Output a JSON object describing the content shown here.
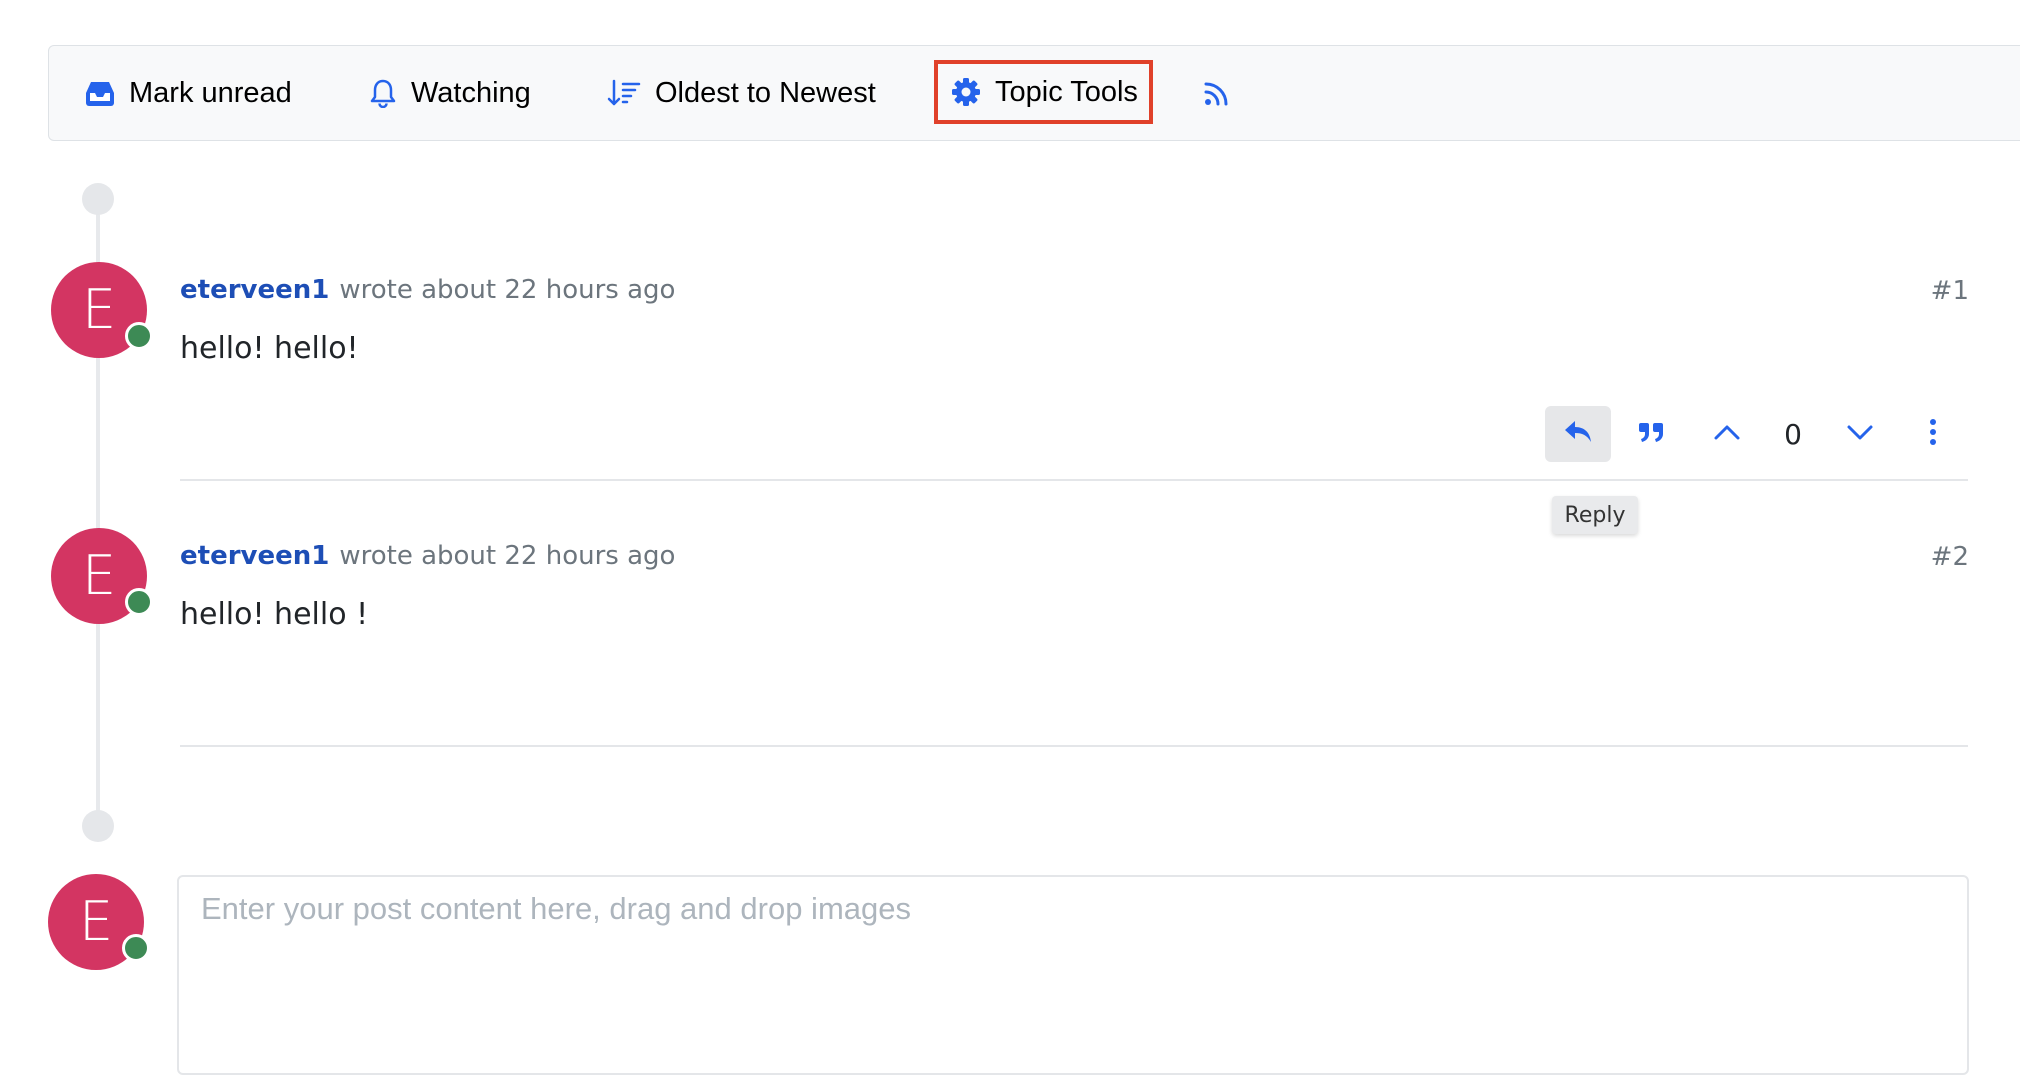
{
  "toolbar": {
    "mark_unread": "Mark unread",
    "watching": "Watching",
    "sort": "Oldest to Newest",
    "topic_tools": "Topic Tools"
  },
  "colors": {
    "accent": "#2563eb",
    "avatar": "#d33562",
    "online": "#3d8a55",
    "highlight_border": "#e0412a",
    "username": "#1d4eb6"
  },
  "posts": [
    {
      "avatar_letter": "E",
      "username": "eterveen1",
      "meta": "wrote about 22 hours ago",
      "index": "#1",
      "content": "hello! hello!",
      "votes": "0"
    },
    {
      "avatar_letter": "E",
      "username": "eterveen1",
      "meta": "wrote about 22 hours ago",
      "index": "#2",
      "content": "hello! hello !"
    }
  ],
  "tooltip": "Reply",
  "composer": {
    "avatar_letter": "E",
    "placeholder": "Enter your post content here, drag and drop images"
  }
}
